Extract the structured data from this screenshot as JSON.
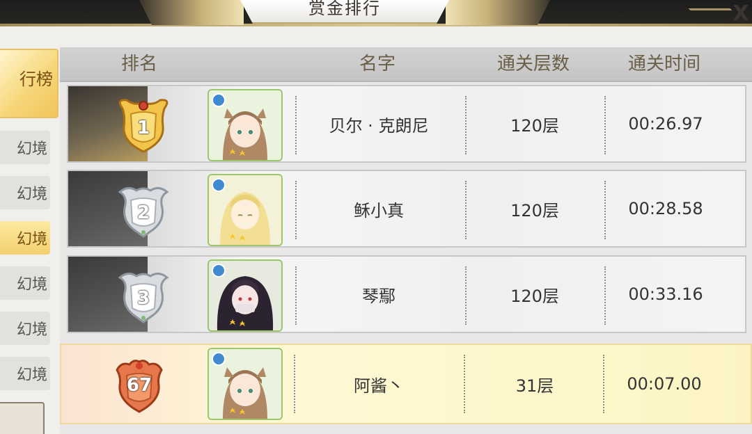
{
  "title": "赏金排行",
  "close_label": "X",
  "tabs": [
    {
      "label": "行榜",
      "state": "active"
    },
    {
      "label": "幻境",
      "state": "normal"
    },
    {
      "label": "幻境",
      "state": "normal"
    },
    {
      "label": "幻境",
      "state": "highlight"
    },
    {
      "label": "幻境",
      "state": "normal"
    },
    {
      "label": "幻境",
      "state": "normal"
    },
    {
      "label": "幻境",
      "state": "normal"
    }
  ],
  "columns": {
    "rank": "排名",
    "name": "名字",
    "floors": "通关层数",
    "time": "通关时间"
  },
  "rows": [
    {
      "rank": "1",
      "name": "贝尔 · 克朗尼",
      "floors": "120层",
      "time": "00:26.97",
      "badge": "gold",
      "portrait": "fox-girl-brown-hair"
    },
    {
      "rank": "2",
      "name": "稣小真",
      "floors": "120层",
      "time": "00:28.58",
      "badge": "silver",
      "portrait": "blonde-girl"
    },
    {
      "rank": "3",
      "name": "琴鄢",
      "floors": "120层",
      "time": "00:33.16",
      "badge": "silver",
      "portrait": "dark-haired-girl"
    }
  ],
  "my_row": {
    "rank": "67",
    "name": "阿酱丶",
    "floors": "31层",
    "time": "00:07.00",
    "badge": "bronze",
    "portrait": "fox-girl-brown-hair"
  },
  "colors": {
    "gold": "#f2c44a",
    "silver": "#cfd3d8",
    "bronze": "#e5774a",
    "highlight_row": "#fdf7c9",
    "header": "#cdcdcd",
    "header_text": "#6b5e48"
  }
}
